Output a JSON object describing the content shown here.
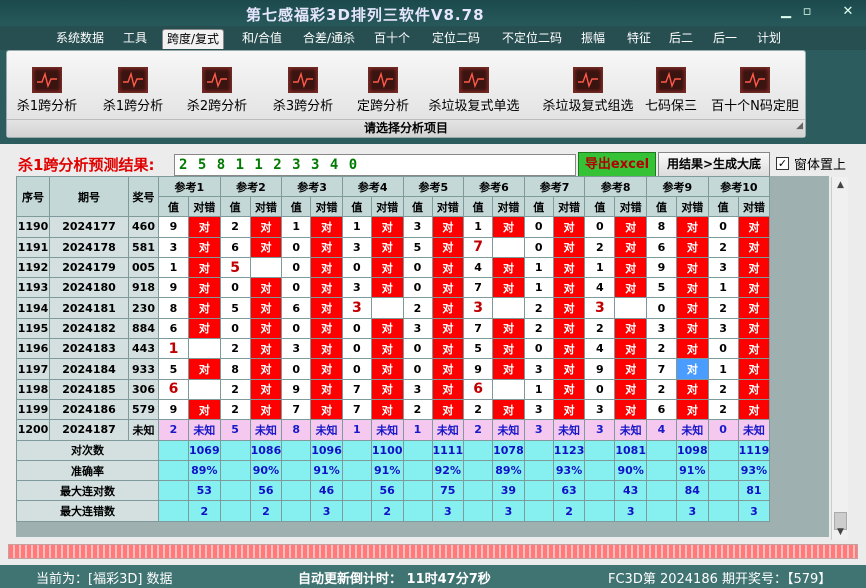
{
  "app": {
    "title": "第七感福彩3D排列三软件V8.78",
    "min": "▁",
    "max": "▫",
    "close": "✕"
  },
  "menu": {
    "items": [
      "系统数据",
      "工具",
      "跨度/复式",
      "和/合值",
      "合差/通杀",
      "百十个",
      "定位二码",
      "不定位二码",
      "振幅",
      "特征",
      "后二",
      "后一",
      "计划"
    ],
    "active_index": 2
  },
  "ribbon": {
    "tools": [
      "杀1跨分析",
      "杀1跨分析",
      "杀2跨分析",
      "杀3跨分析",
      "定跨分析",
      "杀垃圾复式单选",
      "杀垃圾复式组选",
      "七码保三",
      "百十个N码定胆"
    ],
    "footer": "请选择分析项目"
  },
  "prediction": {
    "label": "杀1跨分析预测结果:",
    "value": "2 5 8 1 1 2 3 3 4 0",
    "excel_button": "导出excel",
    "generate_button": "用结果>生成大底",
    "stay_on_top_label": "窗体置上",
    "stay_on_top_checked": true
  },
  "table": {
    "headers": {
      "seq": "序号",
      "period": "期号",
      "prize": "奖号",
      "refs": [
        "参考1",
        "参考2",
        "参考3",
        "参考4",
        "参考5",
        "参考6",
        "参考7",
        "参考8",
        "参考9",
        "参考10"
      ],
      "sub_value": "值",
      "sub_result": "对错"
    },
    "rows": [
      {
        "seq": "1190",
        "period": "2024177",
        "prize": "460",
        "cells": [
          [
            "9",
            "对"
          ],
          [
            "2",
            "对"
          ],
          [
            "1",
            "对"
          ],
          [
            "1",
            "对"
          ],
          [
            "3",
            "对"
          ],
          [
            "1",
            "对"
          ],
          [
            "0",
            "对"
          ],
          [
            "0",
            "对"
          ],
          [
            "8",
            "对"
          ],
          [
            "0",
            "对"
          ]
        ]
      },
      {
        "seq": "1191",
        "period": "2024178",
        "prize": "581",
        "cells": [
          [
            "3",
            "对"
          ],
          [
            "6",
            "对"
          ],
          [
            "0",
            "对"
          ],
          [
            "3",
            "对"
          ],
          [
            "5",
            "对"
          ],
          [
            "7",
            "!"
          ],
          [
            "0",
            "对"
          ],
          [
            "2",
            "对"
          ],
          [
            "6",
            "对"
          ],
          [
            "2",
            "对"
          ]
        ]
      },
      {
        "seq": "1192",
        "period": "2024179",
        "prize": "005",
        "cells": [
          [
            "1",
            "对"
          ],
          [
            "5",
            "!"
          ],
          [
            "0",
            "对"
          ],
          [
            "0",
            "对"
          ],
          [
            "0",
            "对"
          ],
          [
            "4",
            "对"
          ],
          [
            "1",
            "对"
          ],
          [
            "1",
            "对"
          ],
          [
            "9",
            "对"
          ],
          [
            "3",
            "对"
          ]
        ]
      },
      {
        "seq": "1193",
        "period": "2024180",
        "prize": "918",
        "cells": [
          [
            "9",
            "对"
          ],
          [
            "0",
            "对"
          ],
          [
            "0",
            "对"
          ],
          [
            "3",
            "对"
          ],
          [
            "0",
            "对"
          ],
          [
            "7",
            "对"
          ],
          [
            "1",
            "对"
          ],
          [
            "4",
            "对"
          ],
          [
            "5",
            "对"
          ],
          [
            "1",
            "对"
          ]
        ]
      },
      {
        "seq": "1194",
        "period": "2024181",
        "prize": "230",
        "cells": [
          [
            "8",
            "对"
          ],
          [
            "5",
            "对"
          ],
          [
            "6",
            "对"
          ],
          [
            "3",
            "!"
          ],
          [
            "2",
            "对"
          ],
          [
            "3",
            "!"
          ],
          [
            "2",
            "对"
          ],
          [
            "3",
            "!"
          ],
          [
            "0",
            "对"
          ],
          [
            "2",
            "对"
          ]
        ]
      },
      {
        "seq": "1195",
        "period": "2024182",
        "prize": "884",
        "cells": [
          [
            "6",
            "对"
          ],
          [
            "0",
            "对"
          ],
          [
            "0",
            "对"
          ],
          [
            "0",
            "对"
          ],
          [
            "3",
            "对"
          ],
          [
            "7",
            "对"
          ],
          [
            "2",
            "对"
          ],
          [
            "2",
            "对"
          ],
          [
            "3",
            "对"
          ],
          [
            "3",
            "对"
          ]
        ]
      },
      {
        "seq": "1196",
        "period": "2024183",
        "prize": "443",
        "cells": [
          [
            "1",
            "!"
          ],
          [
            "2",
            "对"
          ],
          [
            "3",
            "对"
          ],
          [
            "0",
            "对"
          ],
          [
            "0",
            "对"
          ],
          [
            "5",
            "对"
          ],
          [
            "0",
            "对"
          ],
          [
            "4",
            "对"
          ],
          [
            "2",
            "对"
          ],
          [
            "0",
            "对"
          ]
        ]
      },
      {
        "seq": "1197",
        "period": "2024184",
        "prize": "933",
        "cells": [
          [
            "5",
            "对"
          ],
          [
            "8",
            "对"
          ],
          [
            "0",
            "对"
          ],
          [
            "0",
            "对"
          ],
          [
            "0",
            "对"
          ],
          [
            "9",
            "对"
          ],
          [
            "3",
            "对"
          ],
          [
            "9",
            "对"
          ],
          [
            "7",
            "对*"
          ],
          [
            "1",
            "对"
          ]
        ]
      },
      {
        "seq": "1198",
        "period": "2024185",
        "prize": "306",
        "cells": [
          [
            "6",
            "!"
          ],
          [
            "2",
            "对"
          ],
          [
            "9",
            "对"
          ],
          [
            "7",
            "对"
          ],
          [
            "3",
            "对"
          ],
          [
            "6",
            "!"
          ],
          [
            "1",
            "对"
          ],
          [
            "0",
            "对"
          ],
          [
            "2",
            "对"
          ],
          [
            "2",
            "对"
          ]
        ]
      },
      {
        "seq": "1199",
        "period": "2024186",
        "prize": "579",
        "cells": [
          [
            "9",
            "对"
          ],
          [
            "2",
            "对"
          ],
          [
            "7",
            "对"
          ],
          [
            "7",
            "对"
          ],
          [
            "2",
            "对"
          ],
          [
            "2",
            "对"
          ],
          [
            "3",
            "对"
          ],
          [
            "3",
            "对"
          ],
          [
            "6",
            "对"
          ],
          [
            "2",
            "对"
          ]
        ]
      },
      {
        "seq": "1200",
        "period": "2024187",
        "prize": "未知",
        "cells": [
          [
            "2",
            "未知"
          ],
          [
            "5",
            "未知"
          ],
          [
            "8",
            "未知"
          ],
          [
            "1",
            "未知"
          ],
          [
            "1",
            "未知"
          ],
          [
            "2",
            "未知"
          ],
          [
            "3",
            "未知"
          ],
          [
            "3",
            "未知"
          ],
          [
            "4",
            "未知"
          ],
          [
            "0",
            "未知"
          ]
        ]
      }
    ],
    "stats": [
      {
        "label": "对次数",
        "values": [
          "1069",
          "1086",
          "1096",
          "1100",
          "1111",
          "1078",
          "1123",
          "1081",
          "1098",
          "1119"
        ]
      },
      {
        "label": "准确率",
        "values": [
          "89%",
          "90%",
          "91%",
          "91%",
          "92%",
          "89%",
          "93%",
          "90%",
          "91%",
          "93%"
        ]
      },
      {
        "label": "最大连对数",
        "values": [
          "53",
          "56",
          "46",
          "56",
          "75",
          "39",
          "63",
          "43",
          "84",
          "81"
        ]
      },
      {
        "label": "最大连错数",
        "values": [
          "2",
          "2",
          "3",
          "2",
          "3",
          "3",
          "2",
          "3",
          "3",
          "3"
        ]
      }
    ]
  },
  "status": {
    "current": "当前为：[福彩3D] 数据",
    "countdown": "自动更新倒计时：  11时47分7秒",
    "latest": "FC3D第 2024186 期开奖号：【579】"
  }
}
